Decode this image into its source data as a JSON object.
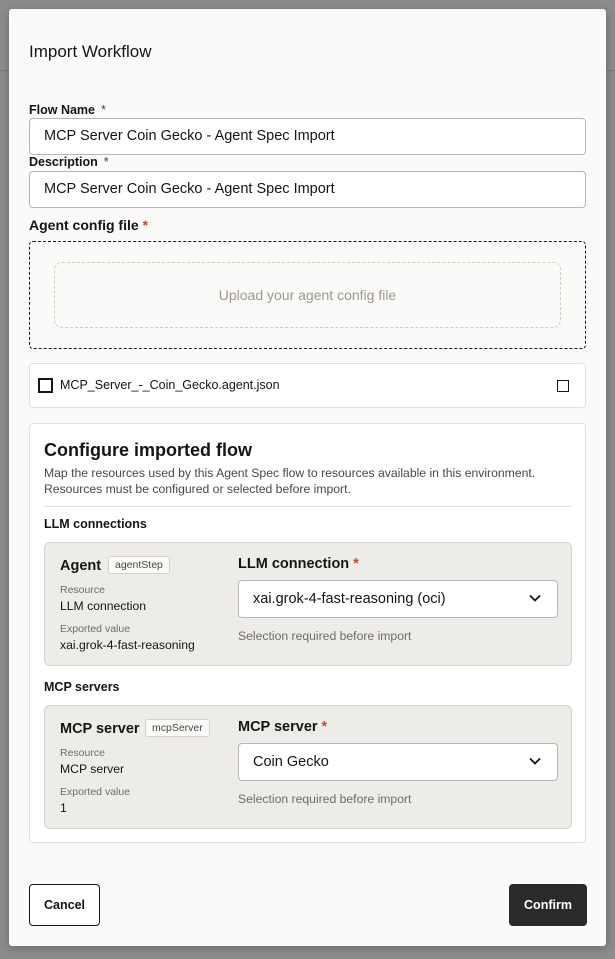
{
  "modal": {
    "title": "Import Workflow"
  },
  "form": {
    "flow_name": {
      "label": "Flow Name",
      "required_mark": "*",
      "value": "MCP Server Coin Gecko - Agent Spec Import"
    },
    "description": {
      "label": "Description",
      "required_mark": "*",
      "value": "MCP Server Coin Gecko - Agent Spec Import"
    },
    "agent_config": {
      "label": "Agent config file",
      "required_mark": "*",
      "upload_prompt": "Upload your agent config file"
    },
    "file": {
      "name": "MCP_Server_-_Coin_Gecko.agent.json"
    }
  },
  "configure": {
    "title": "Configure imported flow",
    "description": "Map the resources used by this Agent Spec flow to resources available in this environment. Resources must be configured or selected before import.",
    "llm_section": {
      "heading": "LLM connections",
      "card": {
        "name": "Agent",
        "tag": "agentStep",
        "resource_label": "Resource",
        "resource_value": "LLM connection",
        "exported_label": "Exported value",
        "exported_value": "xai.grok-4-fast-reasoning",
        "select_label": "LLM connection",
        "required_mark": "*",
        "selected": "xai.grok-4-fast-reasoning (oci)",
        "hint": "Selection required before import"
      }
    },
    "mcp_section": {
      "heading": "MCP servers",
      "card": {
        "name": "MCP server",
        "tag": "mcpServer",
        "resource_label": "Resource",
        "resource_value": "MCP server",
        "exported_label": "Exported value",
        "exported_value": "1",
        "select_label": "MCP server",
        "required_mark": "*",
        "selected": "Coin Gecko",
        "hint": "Selection required before import"
      }
    }
  },
  "footer": {
    "cancel_label": "Cancel",
    "confirm_label": "Confirm"
  },
  "colors": {
    "accent_dark": "#2b2a28",
    "required_red": "#c74634",
    "card_bg": "#edece9"
  }
}
